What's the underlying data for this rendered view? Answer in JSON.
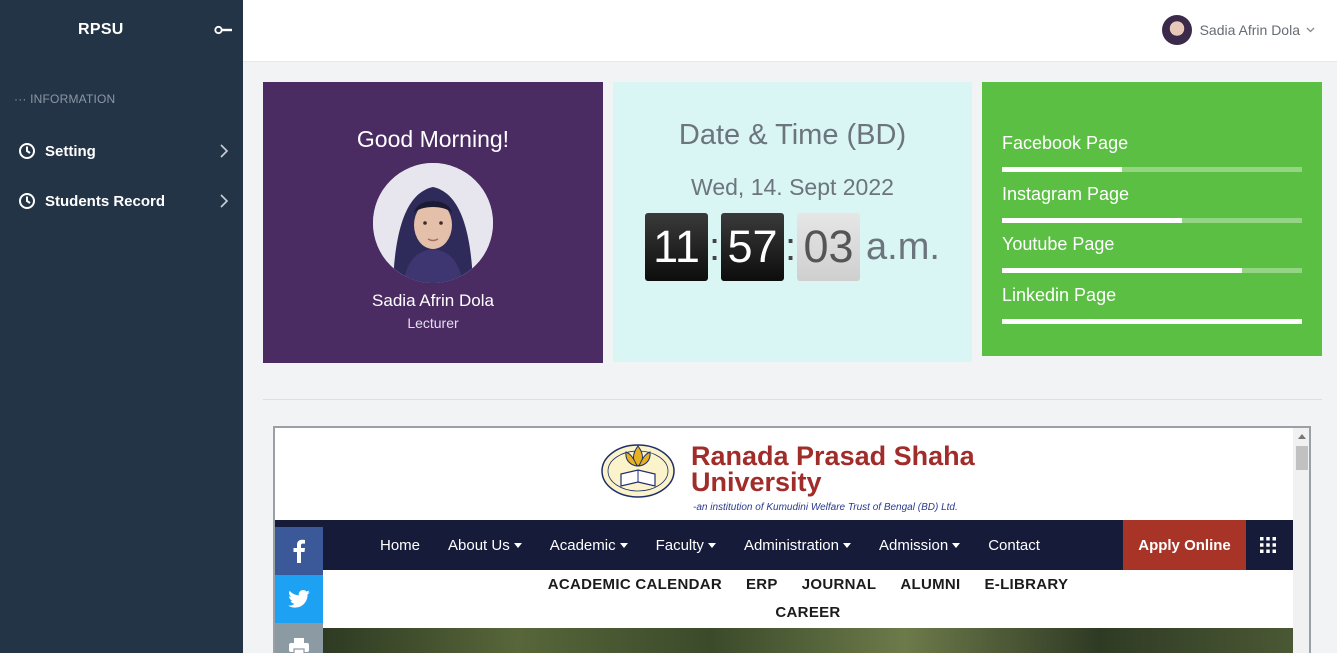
{
  "sidebar": {
    "brand": "RPSU",
    "section": "INFORMATION",
    "items": [
      {
        "label": "Setting"
      },
      {
        "label": "Students Record"
      }
    ]
  },
  "topbar": {
    "user_name": "Sadia Afrin Dola"
  },
  "greeting": {
    "title": "Good Morning!",
    "name": "Sadia Afrin Dola",
    "role": "Lecturer"
  },
  "clock": {
    "title": "Date & Time (BD)",
    "date": "Wed, 14. Sept 2022",
    "hours": "11",
    "minutes": "57",
    "seconds": "03",
    "ampm": "a.m."
  },
  "social": {
    "links": [
      {
        "label": "Facebook Page",
        "progress": 0.4
      },
      {
        "label": "Instagram Page",
        "progress": 0.6
      },
      {
        "label": "Youtube Page",
        "progress": 0.8
      },
      {
        "label": "Linkedin Page",
        "progress": 1.0
      }
    ]
  },
  "website": {
    "name_line1": "Ranada Prasad Shaha",
    "name_line2": "University",
    "tagline": "-an institution of Kumudini Welfare Trust of Bengal (BD) Ltd.",
    "nav": [
      "Home",
      "About Us",
      "Academic",
      "Faculty",
      "Administration",
      "Admission",
      "Contact"
    ],
    "nav_dropdown": [
      false,
      true,
      true,
      true,
      true,
      true,
      false
    ],
    "apply": "Apply Online",
    "subnav_row1": [
      "ACADEMIC CALENDAR",
      "ERP",
      "JOURNAL",
      "ALUMNI",
      "E-LIBRARY"
    ],
    "subnav_row2": [
      "CAREER"
    ]
  },
  "colors": {
    "sidebar_bg": "#243447",
    "greeting_bg": "#4a2c63",
    "clock_bg": "#d9f5f4",
    "social_bg": "#5bbf43",
    "site_nav_bg": "#161b3a",
    "apply_bg": "#a83327",
    "brand_red": "#a12d2a",
    "facebook": "#3b5998",
    "twitter": "#1da1f2",
    "print": "#8c9aa3"
  },
  "icons": {
    "toggle": "toggle-key-icon",
    "nav": "clock-icon",
    "chevron": "chevron-right-icon",
    "share": [
      "facebook-icon",
      "twitter-icon",
      "print-icon"
    ],
    "menu": "grid-icon"
  }
}
